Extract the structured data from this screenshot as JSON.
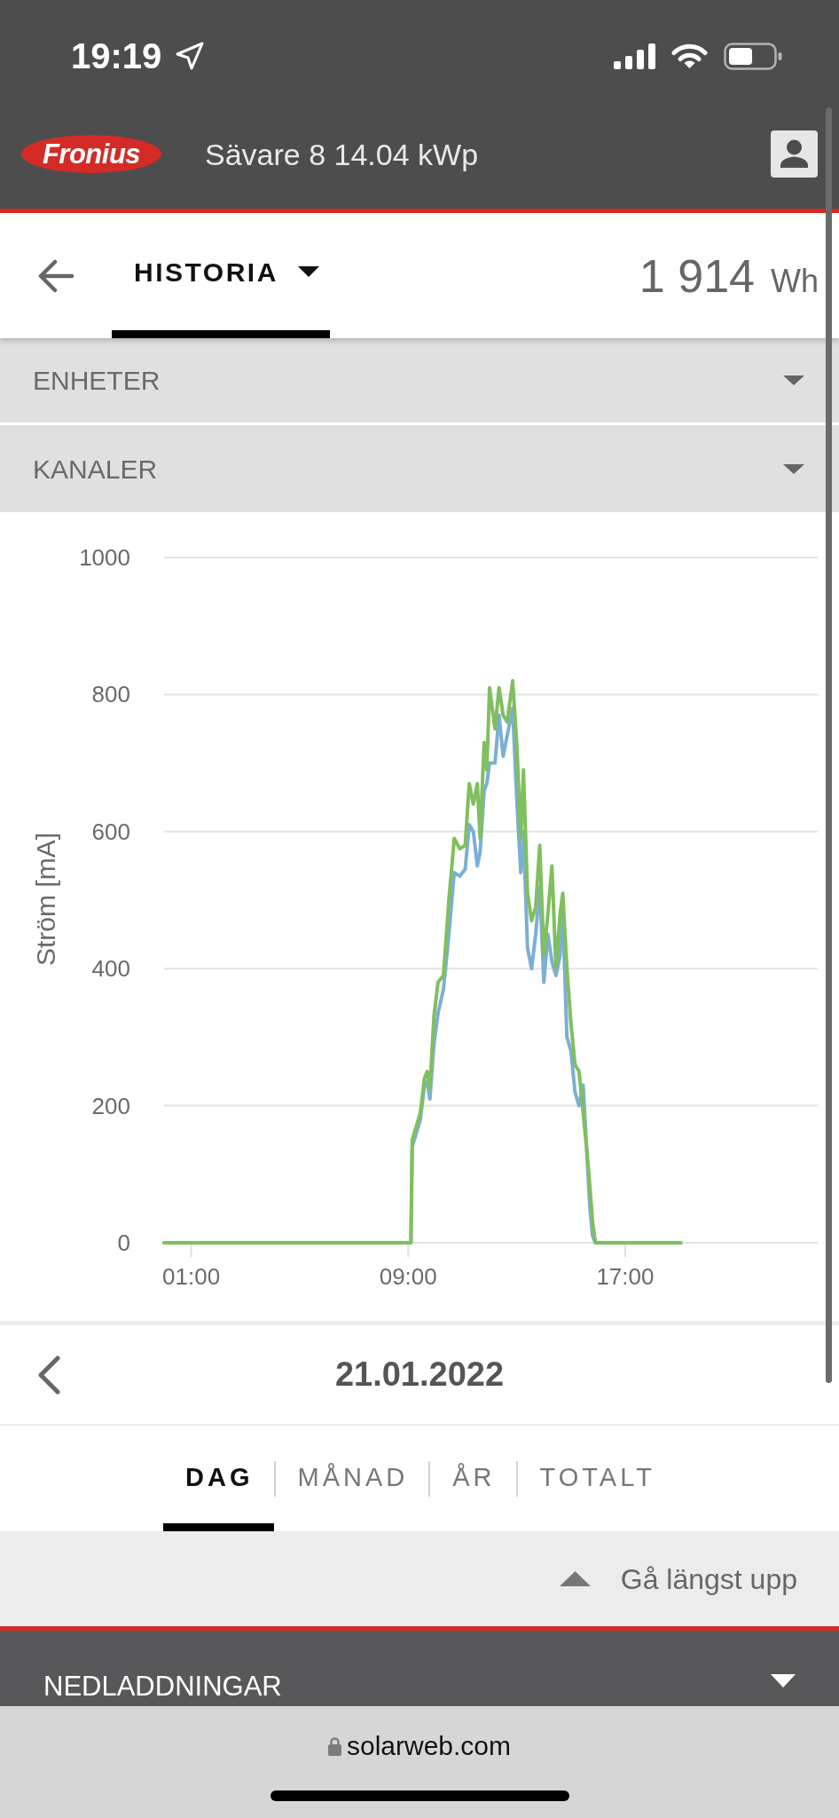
{
  "status_bar": {
    "time": "19:19"
  },
  "header": {
    "logo_text": "Fronius",
    "title": "Sävare 8 14.04 kWp"
  },
  "view": {
    "title": "HISTORIA",
    "selected": true,
    "total": "1 914",
    "unit": "Wh"
  },
  "filters": [
    {
      "label": "ENHETER",
      "expanded": false
    },
    {
      "label": "KANALER",
      "expanded": false
    }
  ],
  "chart": {
    "chart_data": {
      "type": "line",
      "grid": true,
      "ylabel": "Ström [mA]",
      "x": [
        0,
        9.1,
        9.15,
        9.3,
        9.45,
        9.6,
        9.7,
        9.8,
        9.95,
        10.1,
        10.3,
        10.5,
        10.7,
        10.9,
        11.1,
        11.25,
        11.4,
        11.55,
        11.65,
        11.8,
        11.9,
        12,
        12.2,
        12.35,
        12.5,
        12.65,
        12.85,
        13,
        13.15,
        13.25,
        13.4,
        13.55,
        13.7,
        13.85,
        14,
        14.15,
        14.3,
        14.45,
        14.6,
        14.7,
        14.85,
        15,
        15.15,
        15.3,
        15.45,
        15.6,
        15.7,
        15.8,
        15.9,
        19.05
      ],
      "series": [
        {
          "color": "#7bafd4",
          "values": [
            0,
            0,
            140,
            160,
            180,
            230,
            235,
            210,
            290,
            335,
            370,
            450,
            540,
            535,
            545,
            610,
            600,
            550,
            570,
            660,
            670,
            700,
            700,
            770,
            710,
            740,
            780,
            650,
            540,
            600,
            430,
            400,
            450,
            520,
            380,
            450,
            410,
            390,
            420,
            480,
            300,
            280,
            220,
            200,
            230,
            120,
            50,
            10,
            0,
            0
          ]
        },
        {
          "color": "#80bf5e",
          "values": [
            0,
            0,
            150,
            170,
            190,
            240,
            250,
            225,
            330,
            380,
            390,
            500,
            590,
            575,
            580,
            670,
            640,
            670,
            590,
            730,
            690,
            810,
            750,
            810,
            770,
            760,
            820,
            730,
            590,
            690,
            510,
            470,
            490,
            580,
            420,
            480,
            550,
            400,
            480,
            510,
            400,
            320,
            260,
            250,
            190,
            130,
            80,
            30,
            0,
            0
          ]
        }
      ],
      "xlim": [
        0,
        24
      ],
      "ylim": [
        0,
        1000
      ],
      "xticks": [
        {
          "value": 1,
          "label": "01:00"
        },
        {
          "value": 9,
          "label": "09:00"
        },
        {
          "value": 17,
          "label": "17:00"
        }
      ],
      "yticks": [
        0,
        200,
        400,
        600,
        800,
        1000
      ]
    }
  },
  "date_nav": {
    "date": "21.01.2022"
  },
  "periods": [
    {
      "label": "DAG",
      "selected": true
    },
    {
      "label": "MÅNAD",
      "selected": false
    },
    {
      "label": "ÅR",
      "selected": false
    },
    {
      "label": "TOTALT",
      "selected": false
    }
  ],
  "scroll_top": {
    "label": "Gå längst upp"
  },
  "downloads": {
    "label": "NEDLADDNINGAR",
    "expanded": false
  },
  "browser": {
    "url": "solarweb.com"
  }
}
